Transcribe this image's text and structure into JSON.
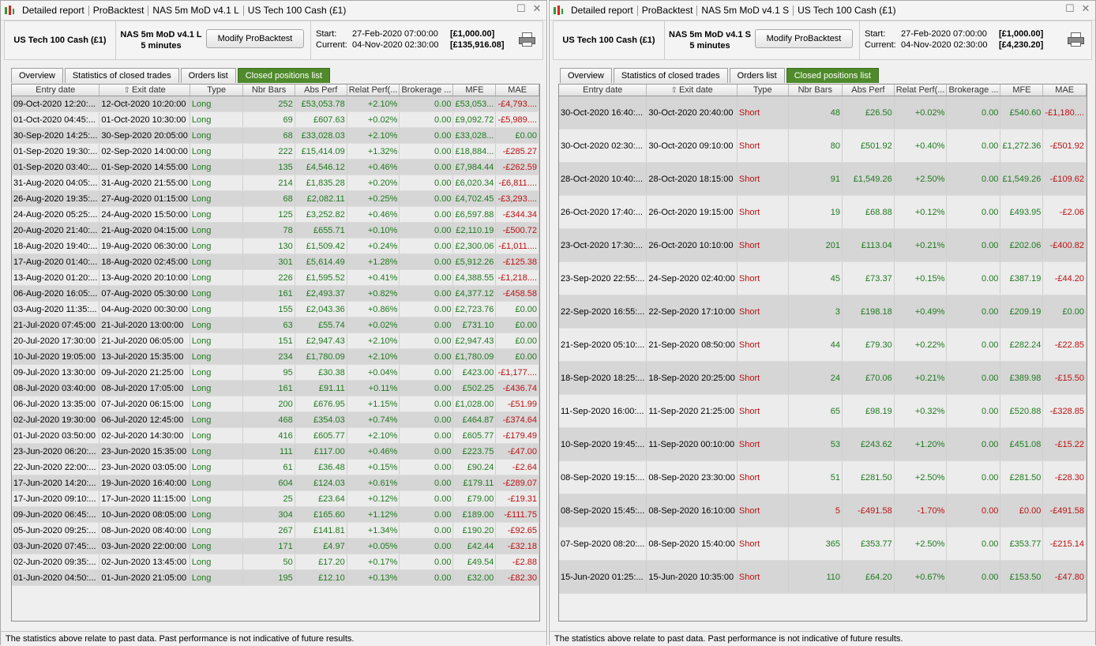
{
  "left": {
    "title": [
      "Detailed report",
      "ProBacktest",
      "NAS 5m MoD v4.1 L",
      "US Tech 100 Cash (£1)"
    ],
    "instrument": "US Tech 100 Cash (£1)",
    "system_name": "NAS 5m MoD v4.1 L",
    "timeframe": "5 minutes",
    "modify_label": "Modify ProBacktest",
    "start_label": "Start:",
    "start_date": "27-Feb-2020 07:00:00",
    "start_amount": "[£1,000.00]",
    "current_label": "Current:",
    "current_date": "04-Nov-2020 02:30:00",
    "current_amount": "[£135,916.08]",
    "tabs": [
      "Overview",
      "Statistics of closed trades",
      "Orders list",
      "Closed positions list"
    ],
    "active_tab": 3,
    "columns": [
      "Entry date",
      "Exit date",
      "Type",
      "Nbr Bars",
      "Abs Perf",
      "Relat Perf(...",
      "Brokerage ...",
      "MFE",
      "MAE"
    ],
    "rows": [
      [
        "09-Oct-2020 12:20:...",
        "12-Oct-2020 10:20:00",
        "Long",
        "252",
        "£53,053.78",
        "+2.10%",
        "0.00",
        "£53,053...",
        "-£4,793...."
      ],
      [
        "01-Oct-2020 04:45:...",
        "01-Oct-2020 10:30:00",
        "Long",
        "69",
        "£607.63",
        "+0.02%",
        "0.00",
        "£9,092.72",
        "-£5,989...."
      ],
      [
        "30-Sep-2020 14:25:...",
        "30-Sep-2020 20:05:00",
        "Long",
        "68",
        "£33,028.03",
        "+2.10%",
        "0.00",
        "£33,028...",
        "£0.00"
      ],
      [
        "01-Sep-2020 19:30:...",
        "02-Sep-2020 14:00:00",
        "Long",
        "222",
        "£15,414.09",
        "+1.32%",
        "0.00",
        "£18,884...",
        "-£285.27"
      ],
      [
        "01-Sep-2020 03:40:...",
        "01-Sep-2020 14:55:00",
        "Long",
        "135",
        "£4,546.12",
        "+0.46%",
        "0.00",
        "£7,984.44",
        "-£262.59"
      ],
      [
        "31-Aug-2020 04:05:...",
        "31-Aug-2020 21:55:00",
        "Long",
        "214",
        "£1,835.28",
        "+0.20%",
        "0.00",
        "£6,020.34",
        "-£6,811...."
      ],
      [
        "26-Aug-2020 19:35:...",
        "27-Aug-2020 01:15:00",
        "Long",
        "68",
        "£2,082.11",
        "+0.25%",
        "0.00",
        "£4,702.45",
        "-£3,293...."
      ],
      [
        "24-Aug-2020 05:25:...",
        "24-Aug-2020 15:50:00",
        "Long",
        "125",
        "£3,252.82",
        "+0.46%",
        "0.00",
        "£6,597.88",
        "-£344.34"
      ],
      [
        "20-Aug-2020 21:40:...",
        "21-Aug-2020 04:15:00",
        "Long",
        "78",
        "£655.71",
        "+0.10%",
        "0.00",
        "£2,110.19",
        "-£500.72"
      ],
      [
        "18-Aug-2020 19:40:...",
        "19-Aug-2020 06:30:00",
        "Long",
        "130",
        "£1,509.42",
        "+0.24%",
        "0.00",
        "£2,300.06",
        "-£1,011...."
      ],
      [
        "17-Aug-2020 01:40:...",
        "18-Aug-2020 02:45:00",
        "Long",
        "301",
        "£5,614.49",
        "+1.28%",
        "0.00",
        "£5,912.26",
        "-£125.38"
      ],
      [
        "13-Aug-2020 01:20:...",
        "13-Aug-2020 20:10:00",
        "Long",
        "226",
        "£1,595.52",
        "+0.41%",
        "0.00",
        "£4,388.55",
        "-£1,218...."
      ],
      [
        "06-Aug-2020 16:05:...",
        "07-Aug-2020 05:30:00",
        "Long",
        "161",
        "£2,493.37",
        "+0.82%",
        "0.00",
        "£4,377.12",
        "-£458.58"
      ],
      [
        "03-Aug-2020 11:35:...",
        "04-Aug-2020 00:30:00",
        "Long",
        "155",
        "£2,043.36",
        "+0.86%",
        "0.00",
        "£2,723.76",
        "£0.00"
      ],
      [
        "21-Jul-2020 07:45:00",
        "21-Jul-2020 13:00:00",
        "Long",
        "63",
        "£55.74",
        "+0.02%",
        "0.00",
        "£731.10",
        "£0.00"
      ],
      [
        "20-Jul-2020 17:30:00",
        "21-Jul-2020 06:05:00",
        "Long",
        "151",
        "£2,947.43",
        "+2.10%",
        "0.00",
        "£2,947.43",
        "£0.00"
      ],
      [
        "10-Jul-2020 19:05:00",
        "13-Jul-2020 15:35:00",
        "Long",
        "234",
        "£1,780.09",
        "+2.10%",
        "0.00",
        "£1,780.09",
        "£0.00"
      ],
      [
        "09-Jul-2020 13:30:00",
        "09-Jul-2020 21:25:00",
        "Long",
        "95",
        "£30.38",
        "+0.04%",
        "0.00",
        "£423.00",
        "-£1,177...."
      ],
      [
        "08-Jul-2020 03:40:00",
        "08-Jul-2020 17:05:00",
        "Long",
        "161",
        "£91.11",
        "+0.11%",
        "0.00",
        "£502.25",
        "-£436.74"
      ],
      [
        "06-Jul-2020 13:35:00",
        "07-Jul-2020 06:15:00",
        "Long",
        "200",
        "£676.95",
        "+1.15%",
        "0.00",
        "£1,028.00",
        "-£51.99"
      ],
      [
        "02-Jul-2020 19:30:00",
        "06-Jul-2020 12:45:00",
        "Long",
        "468",
        "£354.03",
        "+0.74%",
        "0.00",
        "£464.87",
        "-£374.64"
      ],
      [
        "01-Jul-2020 03:50:00",
        "02-Jul-2020 14:30:00",
        "Long",
        "416",
        "£605.77",
        "+2.10%",
        "0.00",
        "£605.77",
        "-£179.49"
      ],
      [
        "23-Jun-2020 06:20:...",
        "23-Jun-2020 15:35:00",
        "Long",
        "111",
        "£117.00",
        "+0.46%",
        "0.00",
        "£223.75",
        "-£47.00"
      ],
      [
        "22-Jun-2020 22:00:...",
        "23-Jun-2020 03:05:00",
        "Long",
        "61",
        "£36.48",
        "+0.15%",
        "0.00",
        "£90.24",
        "-£2.64"
      ],
      [
        "17-Jun-2020 14:20:...",
        "19-Jun-2020 16:40:00",
        "Long",
        "604",
        "£124.03",
        "+0.61%",
        "0.00",
        "£179.11",
        "-£289.07"
      ],
      [
        "17-Jun-2020 09:10:...",
        "17-Jun-2020 11:15:00",
        "Long",
        "25",
        "£23.64",
        "+0.12%",
        "0.00",
        "£79.00",
        "-£19.31"
      ],
      [
        "09-Jun-2020 06:45:...",
        "10-Jun-2020 08:05:00",
        "Long",
        "304",
        "£165.60",
        "+1.12%",
        "0.00",
        "£189.00",
        "-£111.75"
      ],
      [
        "05-Jun-2020 09:25:...",
        "08-Jun-2020 08:40:00",
        "Long",
        "267",
        "£141.81",
        "+1.34%",
        "0.00",
        "£190.20",
        "-£92.65"
      ],
      [
        "03-Jun-2020 07:45:...",
        "03-Jun-2020 22:00:00",
        "Long",
        "171",
        "£4.97",
        "+0.05%",
        "0.00",
        "£42.44",
        "-£32.18"
      ],
      [
        "02-Jun-2020 09:35:...",
        "02-Jun-2020 13:45:00",
        "Long",
        "50",
        "£17.20",
        "+0.17%",
        "0.00",
        "£49.54",
        "-£2.88"
      ],
      [
        "01-Jun-2020 04:50:...",
        "01-Jun-2020 21:05:00",
        "Long",
        "195",
        "£12.10",
        "+0.13%",
        "0.00",
        "£32.00",
        "-£82.30"
      ]
    ],
    "status": "The statistics above relate to past data. Past performance is not indicative of future results."
  },
  "right": {
    "title": [
      "Detailed report",
      "ProBacktest",
      "NAS 5m MoD v4.1 S",
      "US Tech 100 Cash (£1)"
    ],
    "instrument": "US Tech 100 Cash (£1)",
    "system_name": "NAS 5m MoD v4.1 S",
    "timeframe": "5 minutes",
    "modify_label": "Modify ProBacktest",
    "start_label": "Start:",
    "start_date": "27-Feb-2020 07:00:00",
    "start_amount": "[£1,000.00]",
    "current_label": "Current:",
    "current_date": "04-Nov-2020 02:30:00",
    "current_amount": "[£4,230.20]",
    "tabs": [
      "Overview",
      "Statistics of closed trades",
      "Orders list",
      "Closed positions list"
    ],
    "active_tab": 3,
    "columns": [
      "Entry date",
      "Exit date",
      "Type",
      "Nbr Bars",
      "Abs Perf",
      "Relat Perf(...",
      "Brokerage ...",
      "MFE",
      "MAE"
    ],
    "rows": [
      [
        "30-Oct-2020 16:40:...",
        "30-Oct-2020 20:40:00",
        "Short",
        "48",
        "£26.50",
        "+0.02%",
        "0.00",
        "£540.60",
        "-£1,180...."
      ],
      [
        "30-Oct-2020 02:30:...",
        "30-Oct-2020 09:10:00",
        "Short",
        "80",
        "£501.92",
        "+0.40%",
        "0.00",
        "£1,272.36",
        "-£501.92"
      ],
      [
        "28-Oct-2020 10:40:...",
        "28-Oct-2020 18:15:00",
        "Short",
        "91",
        "£1,549.26",
        "+2.50%",
        "0.00",
        "£1,549.26",
        "-£109.62"
      ],
      [
        "26-Oct-2020 17:40:...",
        "26-Oct-2020 19:15:00",
        "Short",
        "19",
        "£68.88",
        "+0.12%",
        "0.00",
        "£493.95",
        "-£2.06"
      ],
      [
        "23-Oct-2020 17:30:...",
        "26-Oct-2020 10:10:00",
        "Short",
        "201",
        "£113.04",
        "+0.21%",
        "0.00",
        "£202.06",
        "-£400.82"
      ],
      [
        "23-Sep-2020 22:55:...",
        "24-Sep-2020 02:40:00",
        "Short",
        "45",
        "£73.37",
        "+0.15%",
        "0.00",
        "£387.19",
        "-£44.20"
      ],
      [
        "22-Sep-2020 16:55:...",
        "22-Sep-2020 17:10:00",
        "Short",
        "3",
        "£198.18",
        "+0.49%",
        "0.00",
        "£209.19",
        "£0.00"
      ],
      [
        "21-Sep-2020 05:10:...",
        "21-Sep-2020 08:50:00",
        "Short",
        "44",
        "£79.30",
        "+0.22%",
        "0.00",
        "£282.24",
        "-£22.85"
      ],
      [
        "18-Sep-2020 18:25:...",
        "18-Sep-2020 20:25:00",
        "Short",
        "24",
        "£70.06",
        "+0.21%",
        "0.00",
        "£389.98",
        "-£15.50"
      ],
      [
        "11-Sep-2020 16:00:...",
        "11-Sep-2020 21:25:00",
        "Short",
        "65",
        "£98.19",
        "+0.32%",
        "0.00",
        "£520.88",
        "-£328.85"
      ],
      [
        "10-Sep-2020 19:45:...",
        "11-Sep-2020 00:10:00",
        "Short",
        "53",
        "£243.62",
        "+1.20%",
        "0.00",
        "£451.08",
        "-£15.22"
      ],
      [
        "08-Sep-2020 19:15:...",
        "08-Sep-2020 23:30:00",
        "Short",
        "51",
        "£281.50",
        "+2.50%",
        "0.00",
        "£281.50",
        "-£28.30"
      ],
      [
        "08-Sep-2020 15:45:...",
        "08-Sep-2020 16:10:00",
        "Short",
        "5",
        "-£491.58",
        "-1.70%",
        "0.00",
        "£0.00",
        "-£491.58"
      ],
      [
        "07-Sep-2020 08:20:...",
        "08-Sep-2020 15:40:00",
        "Short",
        "365",
        "£353.77",
        "+2.50%",
        "0.00",
        "£353.77",
        "-£215.14"
      ],
      [
        "15-Jun-2020 01:25:...",
        "15-Jun-2020 10:35:00",
        "Short",
        "110",
        "£64.20",
        "+0.67%",
        "0.00",
        "£153.50",
        "-£47.80"
      ]
    ],
    "status": "The statistics above relate to past data. Past performance is not indicative of future results."
  }
}
